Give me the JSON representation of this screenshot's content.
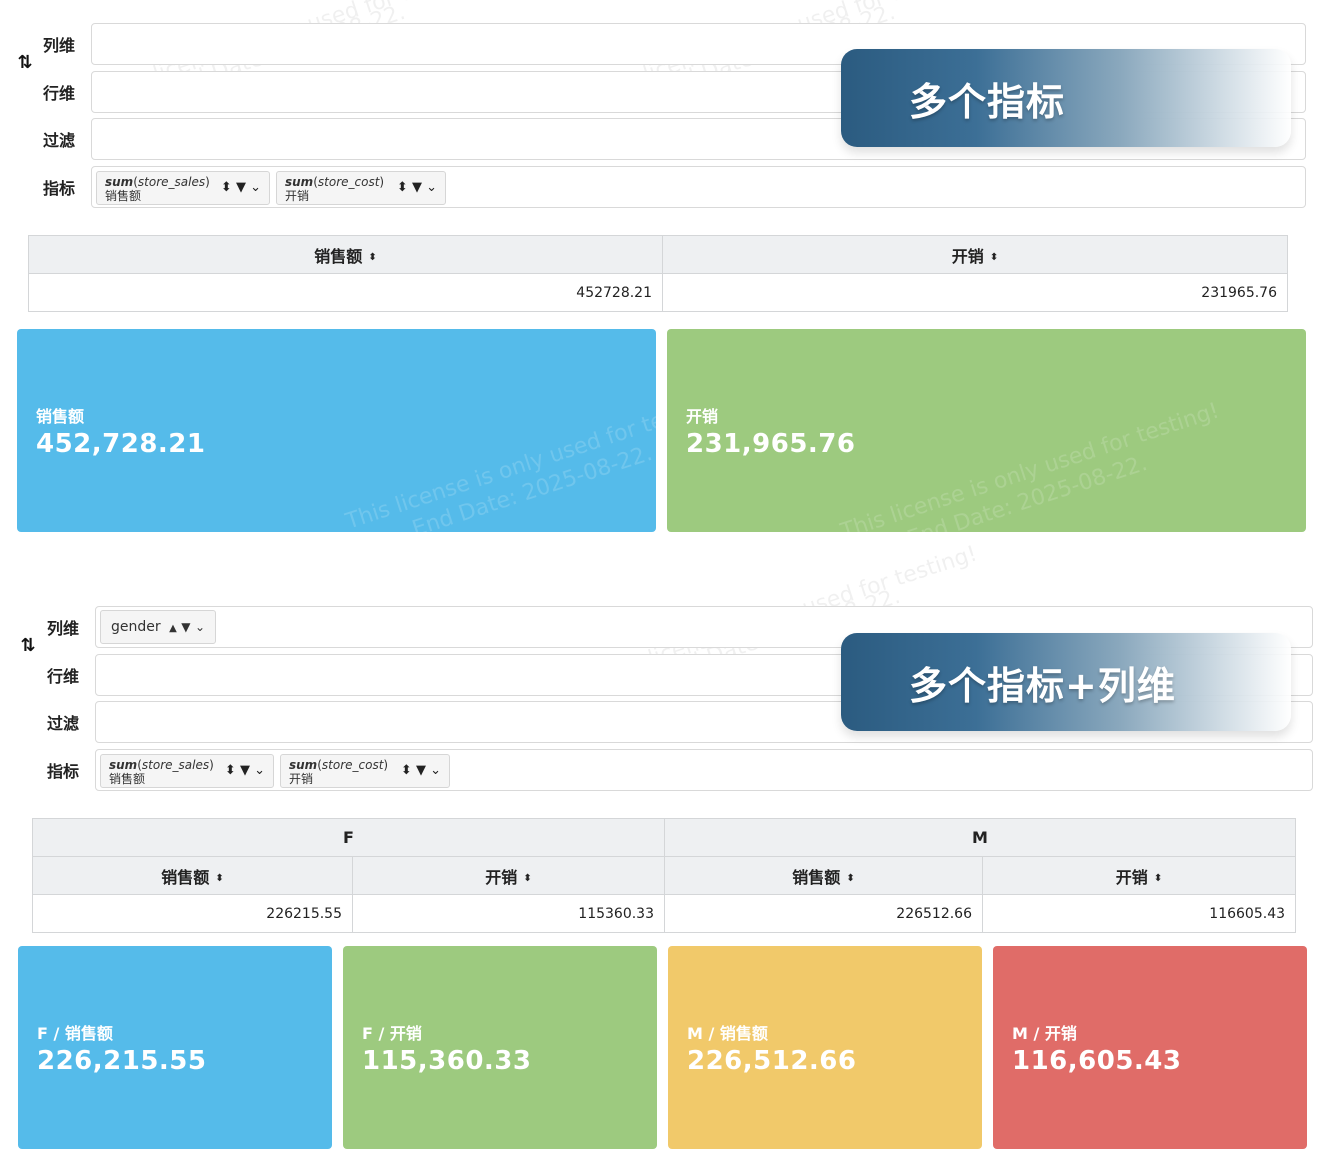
{
  "watermark": {
    "line1": "This license is only used for testing!",
    "line2": "End Date: 2025-08-22."
  },
  "shelf_labels": {
    "columns": "列维",
    "rows": "行维",
    "filter": "过滤",
    "measures": "指标"
  },
  "icons": {
    "swap": "swap-icon",
    "sort": "sort-icon",
    "filter": "filter-icon",
    "chevron": "chevron-down-icon"
  },
  "panel_a": {
    "banner": "多个指标",
    "measures": [
      {
        "func": "sum",
        "field": "store_sales",
        "alias": "销售额"
      },
      {
        "func": "sum",
        "field": "store_cost",
        "alias": "开销"
      }
    ],
    "table": {
      "headers": [
        "销售额",
        "开销"
      ],
      "values": [
        "452728.21",
        "231965.76"
      ]
    },
    "cards": [
      {
        "label": "销售额",
        "value": "452,728.21",
        "color": "#55bbea"
      },
      {
        "label": "开销",
        "value": "231,965.76",
        "color": "#9dca7f"
      }
    ]
  },
  "panel_b": {
    "banner": "多个指标+列维",
    "column_dim": "gender",
    "measures": [
      {
        "func": "sum",
        "field": "store_sales",
        "alias": "销售额"
      },
      {
        "func": "sum",
        "field": "store_cost",
        "alias": "开销"
      }
    ],
    "table": {
      "groups": [
        "F",
        "M"
      ],
      "headers": [
        "销售额",
        "开销",
        "销售额",
        "开销"
      ],
      "values": [
        "226215.55",
        "115360.33",
        "226512.66",
        "116605.43"
      ]
    },
    "cards": [
      {
        "label": "F / 销售额",
        "value": "226,215.55",
        "color": "#55bbea"
      },
      {
        "label": "F / 开销",
        "value": "115,360.33",
        "color": "#9dca7f"
      },
      {
        "label": "M / 销售额",
        "value": "226,512.66",
        "color": "#f1c96a"
      },
      {
        "label": "M / 开销",
        "value": "116,605.43",
        "color": "#e06c68"
      }
    ]
  }
}
